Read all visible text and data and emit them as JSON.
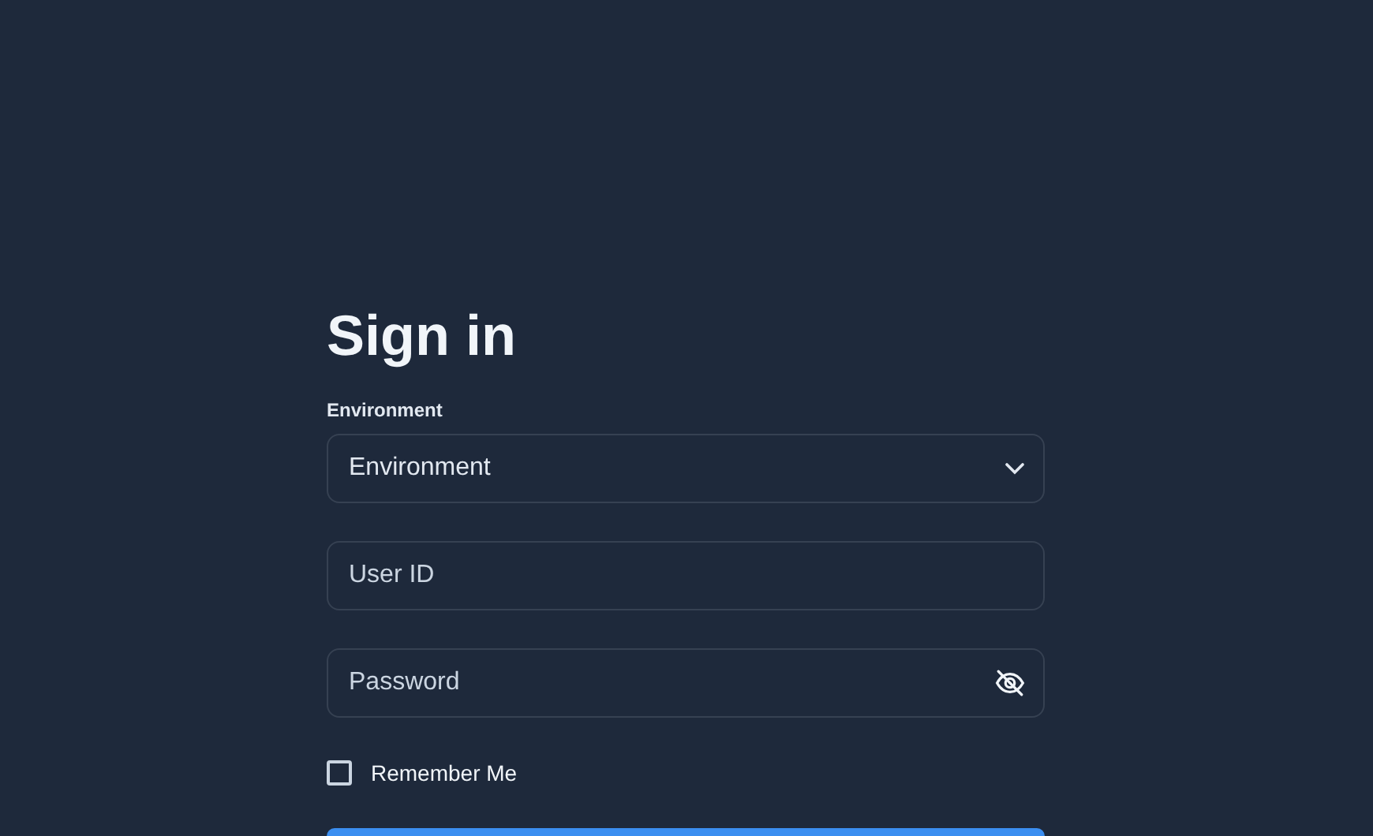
{
  "title": "Sign in",
  "environment": {
    "label": "Environment",
    "placeholder": "Environment"
  },
  "user_id": {
    "placeholder": "User ID"
  },
  "password": {
    "placeholder": "Password",
    "visible": false
  },
  "remember_me": {
    "label": "Remember Me",
    "checked": false
  }
}
